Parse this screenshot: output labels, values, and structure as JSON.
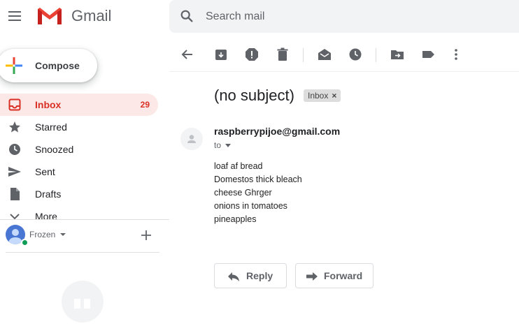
{
  "app": {
    "name": "Gmail"
  },
  "search": {
    "placeholder": "Search mail"
  },
  "compose": {
    "label": "Compose"
  },
  "nav": {
    "items": [
      {
        "label": "Inbox",
        "count": "29",
        "icon": "inbox-icon",
        "active": true
      },
      {
        "label": "Starred",
        "icon": "star-icon"
      },
      {
        "label": "Snoozed",
        "icon": "clock-icon"
      },
      {
        "label": "Sent",
        "icon": "send-icon"
      },
      {
        "label": "Drafts",
        "icon": "draft-icon"
      },
      {
        "label": "More",
        "icon": "chevron-down-icon"
      }
    ]
  },
  "hangouts": {
    "user_name": "Frozen"
  },
  "toolbar": {
    "icons": [
      "back-arrow-icon",
      "archive-icon",
      "report-spam-icon",
      "delete-icon",
      "mark-unread-icon",
      "snooze-icon",
      "move-to-icon",
      "label-icon",
      "more-vert-icon"
    ]
  },
  "message": {
    "subject": "(no subject)",
    "label": "Inbox",
    "label_remove": "×",
    "sender": "raspberrypijoe@gmail.com",
    "to": "to",
    "body": [
      "loaf af bread",
      "Domestos thick bleach",
      "cheese Ghrger",
      "onions in tomatoes",
      "pineapples"
    ]
  },
  "actions": {
    "reply": "Reply",
    "forward": "Forward"
  },
  "colors": {
    "accent_red": "#d93025",
    "inbox_highlight": "#fce8e6",
    "search_bg": "#f1f3f4",
    "icon_gray": "#5f6368",
    "online_green": "#0f9d58"
  }
}
